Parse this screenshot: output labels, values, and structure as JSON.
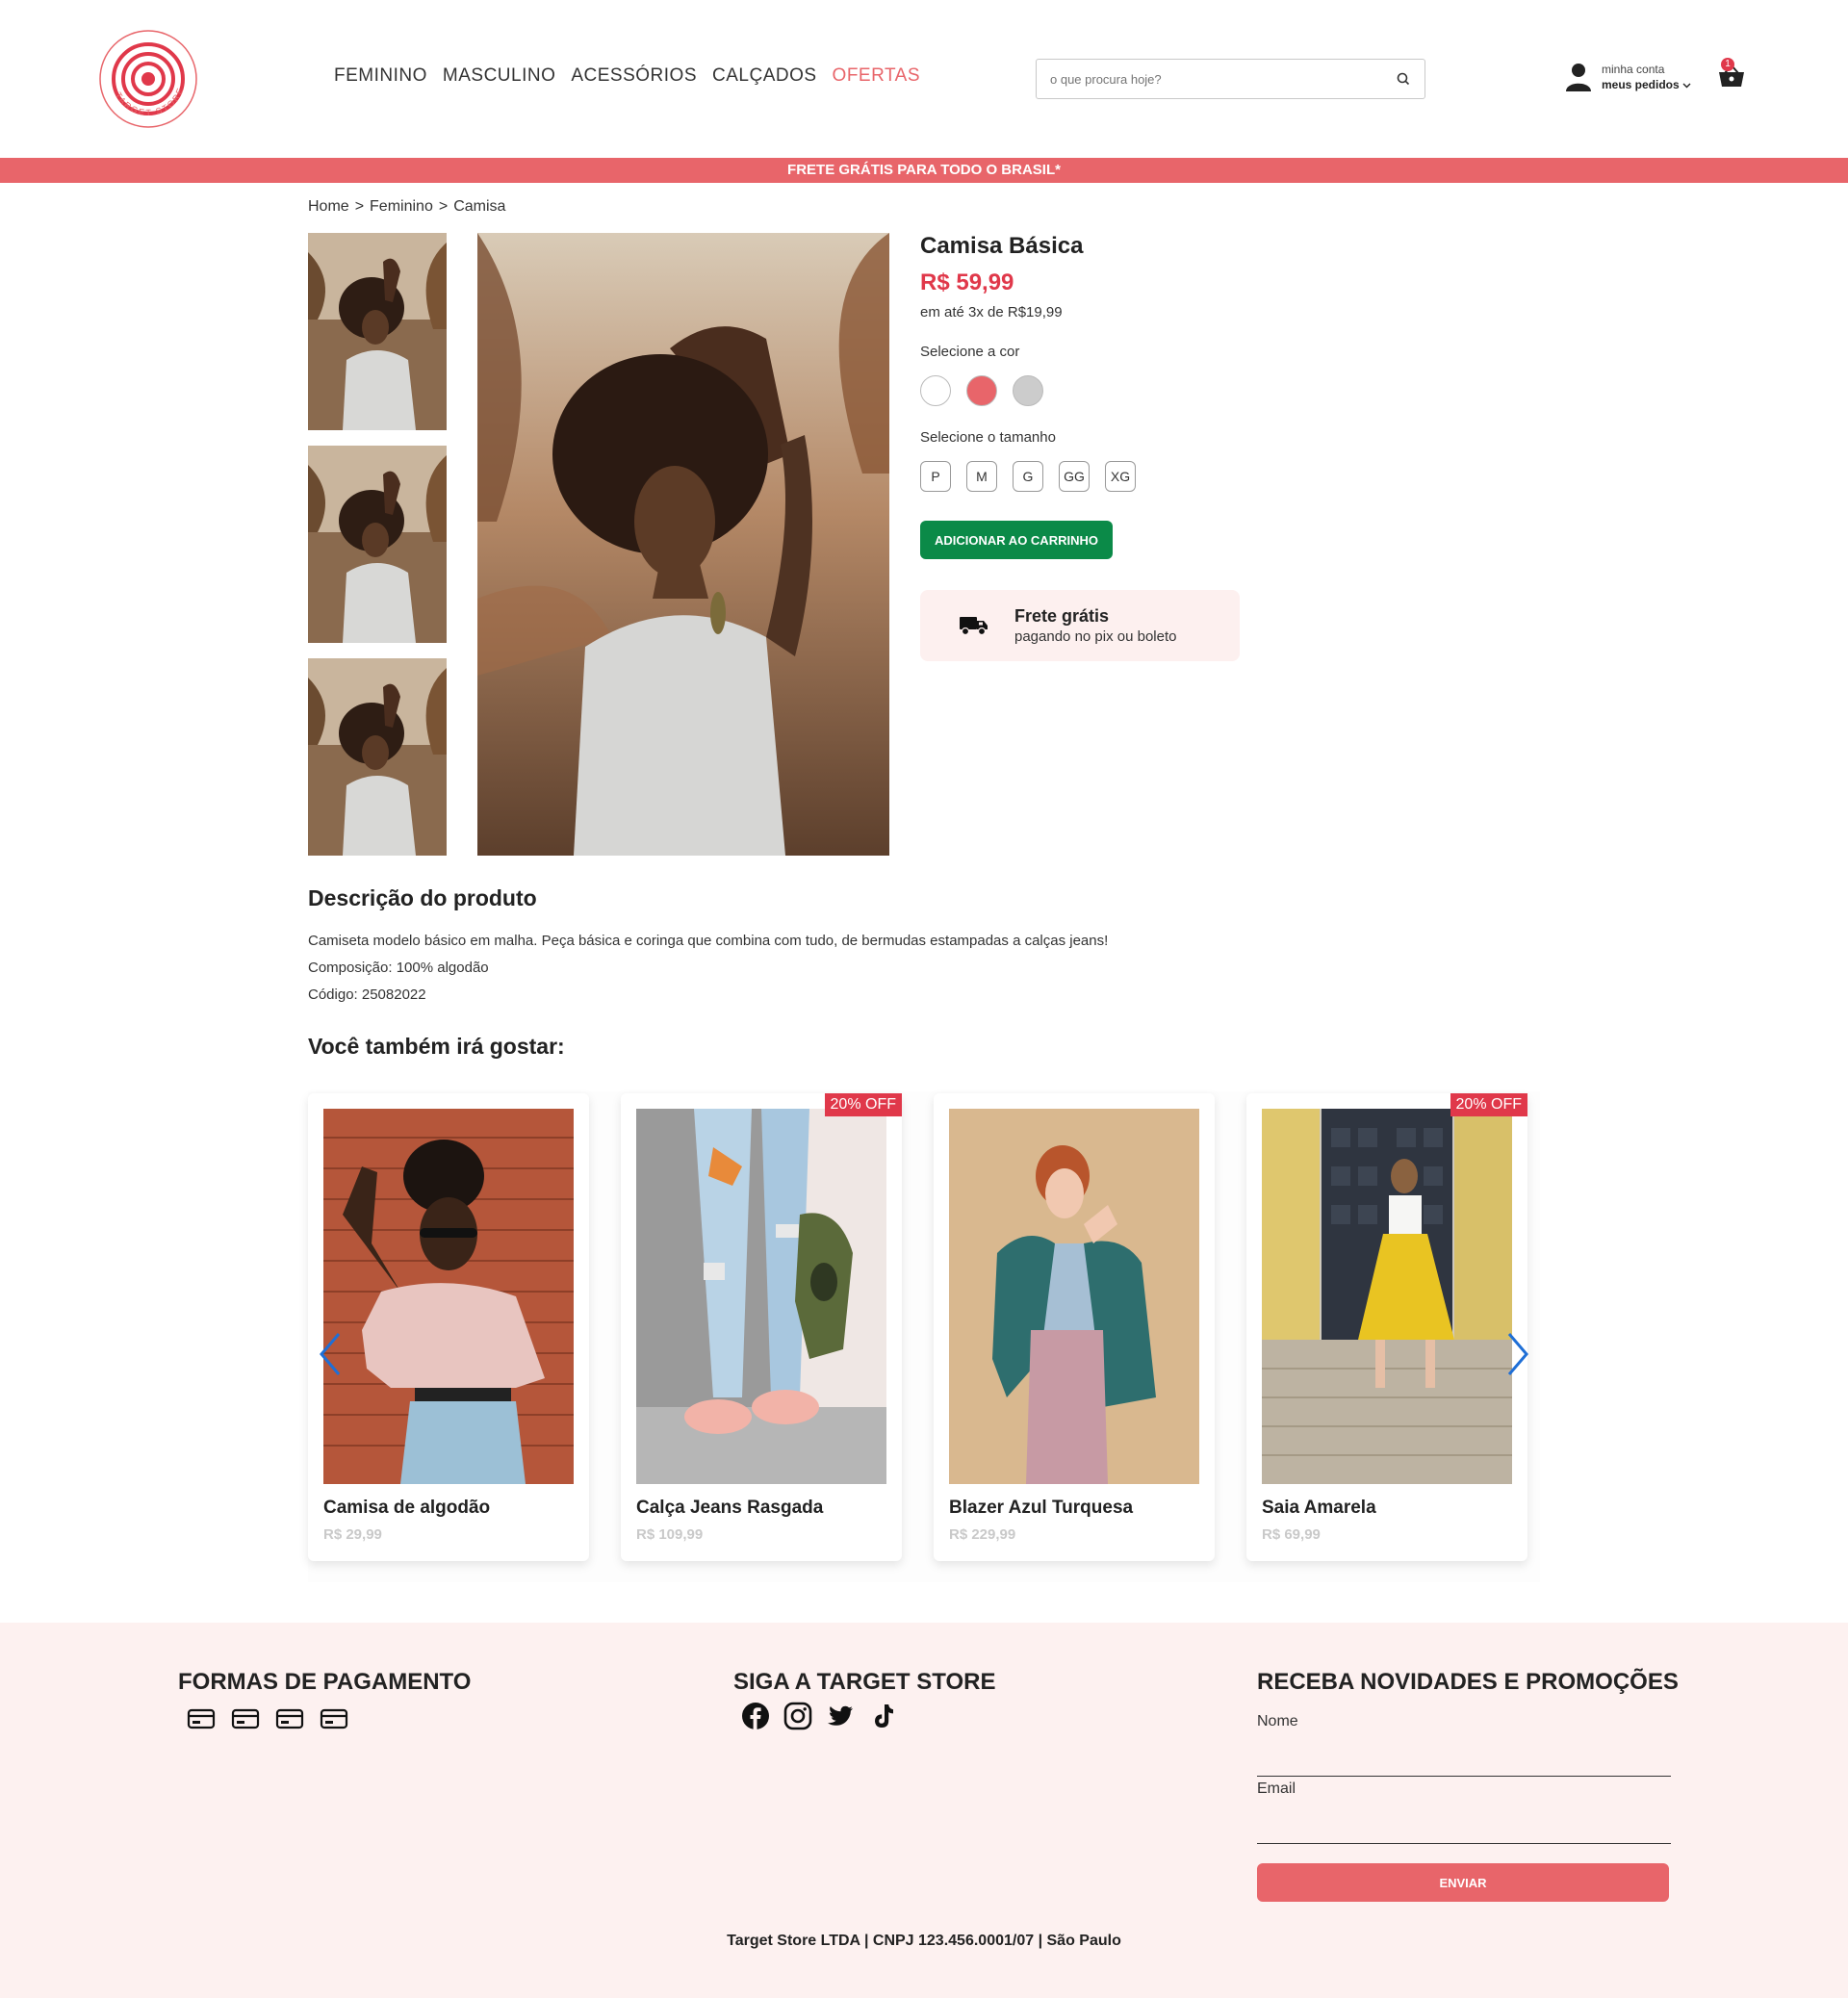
{
  "header": {
    "logo_text": "TARGET STORE",
    "nav": [
      {
        "label": "FEMININO"
      },
      {
        "label": "MASCULINO"
      },
      {
        "label": "ACESSÓRIOS"
      },
      {
        "label": "CALÇADOS"
      },
      {
        "label": "OFERTAS"
      }
    ],
    "search_placeholder": "o que procura hoje?",
    "account_line1": "minha conta",
    "account_line2": "meus pedidos",
    "cart_count": "1"
  },
  "promo_bar": "FRETE GRÁTIS PARA TODO O BRASIL*",
  "breadcrumb": [
    "Home",
    ">",
    "Feminino",
    ">",
    "Camisa"
  ],
  "product": {
    "title": "Camisa Básica",
    "price": "R$ 59,99",
    "installments": "em até 3x de R$19,99",
    "color_label": "Selecione a cor",
    "colors": [
      "#ffffff",
      "#e8656a",
      "#cccccc"
    ],
    "size_label": "Selecione o tamanho",
    "sizes": [
      "P",
      "M",
      "G",
      "GG",
      "XG"
    ],
    "add_to_cart": "ADICIONAR AO CARRINHO",
    "shipping_title": "Frete grátis",
    "shipping_sub": "pagando no pix ou boleto"
  },
  "description": {
    "heading": "Descrição do produto",
    "text": "Camiseta modelo básico em malha. Peça básica e coringa que combina com tudo, de bermudas estampadas a calças jeans!",
    "composition": "Composição: 100% algodão",
    "code": "Código: 25082022"
  },
  "recommendations": {
    "heading": "Você também irá gostar:",
    "items": [
      {
        "name": "Camisa de algodão",
        "price": "R$ 29,99",
        "badge": ""
      },
      {
        "name": "Calça Jeans Rasgada",
        "price": "R$ 109,99",
        "badge": "20% OFF"
      },
      {
        "name": "Blazer Azul Turquesa",
        "price": "R$ 229,99",
        "badge": ""
      },
      {
        "name": "Saia Amarela",
        "price": "R$ 69,99",
        "badge": "20% OFF"
      }
    ]
  },
  "footer": {
    "payment_heading": "FORMAS DE PAGAMENTO",
    "social_heading": "SIGA A TARGET STORE",
    "newsletter_heading": "RECEBA NOVIDADES E PROMOÇÕES",
    "name_label": "Nome",
    "email_label": "Email",
    "submit": "ENVIAR",
    "copyright": "Target Store LTDA | CNPJ 123.456.0001/07 | São Paulo"
  },
  "colors": {
    "accent": "#e8656a",
    "price_red": "#e0384a",
    "cart_green": "#0b8a48",
    "footer_bg": "#fdf1f0"
  }
}
